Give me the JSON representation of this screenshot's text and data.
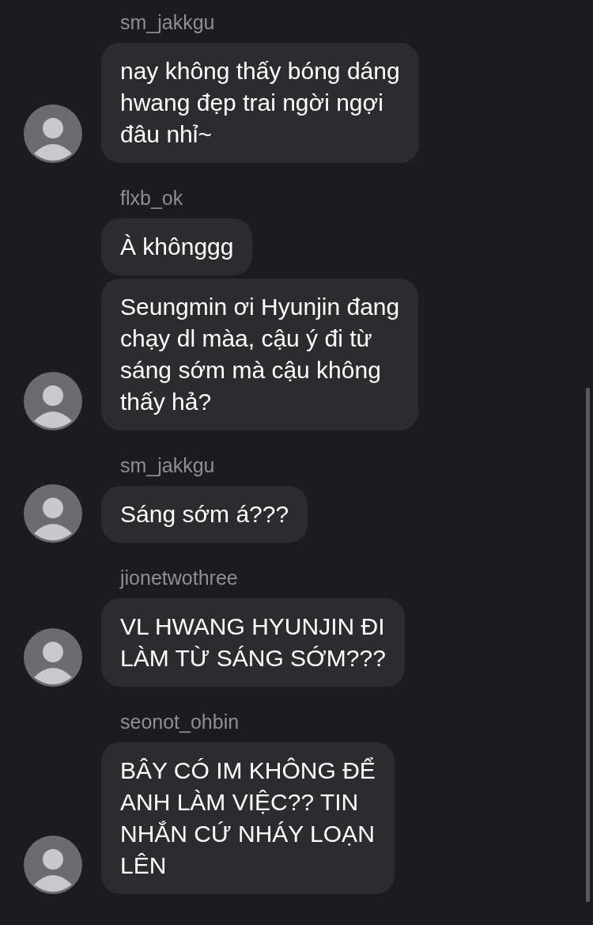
{
  "groups": [
    {
      "username": "sm_jakkgu",
      "messages": [
        "nay không thấy bóng dáng\nhwang đẹp trai ngời ngợi\nđâu nhỉ~"
      ]
    },
    {
      "username": "flxb_ok",
      "messages": [
        "À khônggg",
        "Seungmin ơi Hyunjin đang\nchạy dl màa, cậu ý đi từ\nsáng sớm mà cậu không\nthấy hả?"
      ]
    },
    {
      "username": "sm_jakkgu",
      "messages": [
        "Sáng sớm á???"
      ]
    },
    {
      "username": "jionetwothree",
      "messages": [
        "VL HWANG HYUNJIN ĐI\nLÀM TỪ SÁNG SỚM???"
      ]
    },
    {
      "username": "seonot_ohbin",
      "messages": [
        "BÂY CÓ IM KHÔNG ĐỂ\nANH LÀM VIỆC?? TIN\nNHẮN CỨ NHÁY LOẠN\nLÊN"
      ]
    }
  ]
}
